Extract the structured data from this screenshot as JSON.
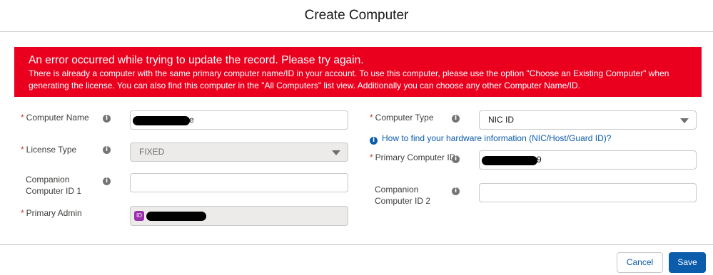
{
  "modal": {
    "title": "Create Computer"
  },
  "error": {
    "title": "An error occurred while trying to update the record. Please try again.",
    "message": "There is already a computer with the same primary computer name/ID in your account. To use this computer, please use the option \"Choose an Existing Computer\" when generating the license. You can also find this computer in the \"All Computers\" list view. Additionally you can choose any other Computer Name/ID.",
    "color": "#ea001e"
  },
  "left_fields": {
    "computer_name": {
      "label": "Computer Name",
      "required": "*",
      "value_visible_suffix": "e"
    },
    "license_type": {
      "label": "License Type",
      "required": "*",
      "value": "FIXED"
    },
    "companion_1": {
      "label_line1": "Companion",
      "label_line2": "Computer ID 1",
      "value": ""
    },
    "primary_admin": {
      "label": "Primary Admin",
      "required": "*"
    }
  },
  "right_fields": {
    "computer_type": {
      "label": "Computer Type",
      "required": "*",
      "value": "NIC ID"
    },
    "help_link": "How to find your hardware information (NIC/Host/Guard ID)?",
    "primary_computer_id": {
      "label": "Primary Computer ID",
      "required": "*",
      "value_visible_suffix": "9"
    },
    "companion_2": {
      "label_line1": "Companion",
      "label_line2": "Computer ID 2",
      "value": ""
    }
  },
  "icons": {
    "info": "i",
    "admin_badge": "ID"
  },
  "footer": {
    "cancel_label": "Cancel",
    "save_label": "Save",
    "brand_color": "#0b5cab"
  }
}
